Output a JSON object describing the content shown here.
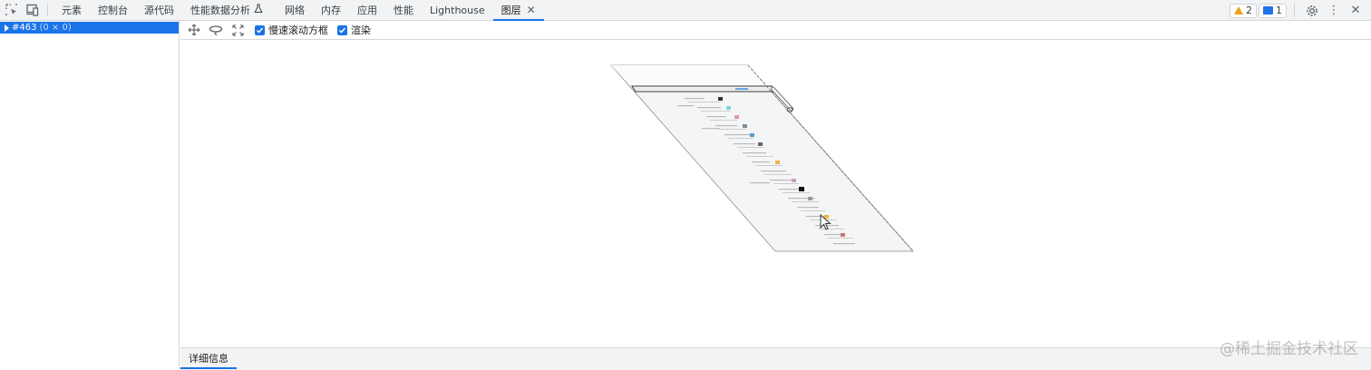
{
  "tabbar": {
    "tabs": [
      {
        "label": "元素"
      },
      {
        "label": "控制台"
      },
      {
        "label": "源代码"
      },
      {
        "label": "性能数据分析"
      },
      {
        "label": "网络"
      },
      {
        "label": "内存"
      },
      {
        "label": "应用"
      },
      {
        "label": "性能"
      },
      {
        "label": "Lighthouse"
      },
      {
        "label": "图层"
      }
    ],
    "active_tab": "图层",
    "warnings_count": "2",
    "messages_count": "1"
  },
  "tree": {
    "node_id": "#463",
    "node_size": "(0 × 0)"
  },
  "toolbar": {
    "slow_scroll_label": "慢速滚动方框",
    "paint_label": "渲染"
  },
  "details": {
    "tab_label": "详细信息"
  },
  "watermark": "@稀土掘金技术社区",
  "colors": {
    "accent": "#1a73e8",
    "warning": "#e8a317"
  }
}
